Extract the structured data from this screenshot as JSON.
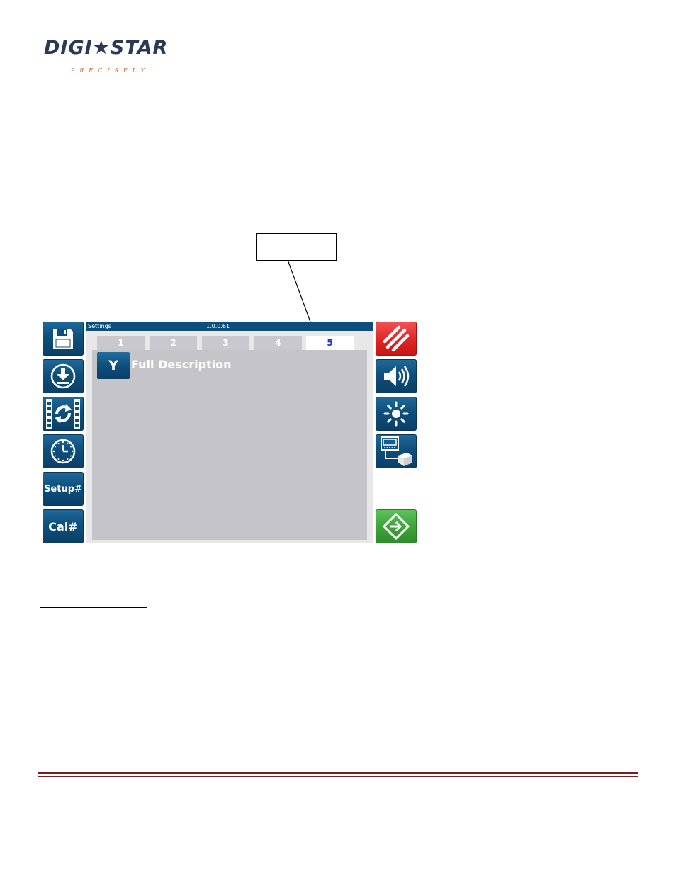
{
  "logo": {
    "brand": "DIGI★STAR",
    "tagline": "PRECISELY"
  },
  "screen": {
    "title": "Settings",
    "version": "1.0.0.61",
    "tabs": [
      {
        "label": "1",
        "active": false
      },
      {
        "label": "2",
        "active": false
      },
      {
        "label": "3",
        "active": false
      },
      {
        "label": "4",
        "active": false
      },
      {
        "label": "5",
        "active": true
      }
    ],
    "option": {
      "value": "Y",
      "label": "Full Description"
    }
  },
  "left_buttons": [
    {
      "name": "save-button",
      "icon": "floppy-disk-icon"
    },
    {
      "name": "download-button",
      "icon": "download-arrow-icon"
    },
    {
      "name": "sync-button",
      "icon": "refresh-arrows-icon"
    },
    {
      "name": "clock-button",
      "icon": "clock-icon"
    },
    {
      "name": "setup-button",
      "label": "Setup#"
    },
    {
      "name": "cal-button",
      "label": "Cal#"
    }
  ],
  "right_buttons": [
    {
      "name": "cancel-button",
      "icon": "diagonal-stripes-icon",
      "color": "#e02828"
    },
    {
      "name": "volume-button",
      "icon": "speaker-icon"
    },
    {
      "name": "brightness-button",
      "icon": "sun-icon"
    },
    {
      "name": "printer-button",
      "icon": "terminal-printer-icon"
    },
    {
      "name": "exit-button",
      "icon": "enter-arrow-icon",
      "color": "#3da63a"
    }
  ],
  "colors": {
    "titlebar": "#0d4f7a",
    "button_blue": "#0e4f7c",
    "active_tab_text": "#1a2fd6",
    "footer_line": "#7a1e1e"
  }
}
